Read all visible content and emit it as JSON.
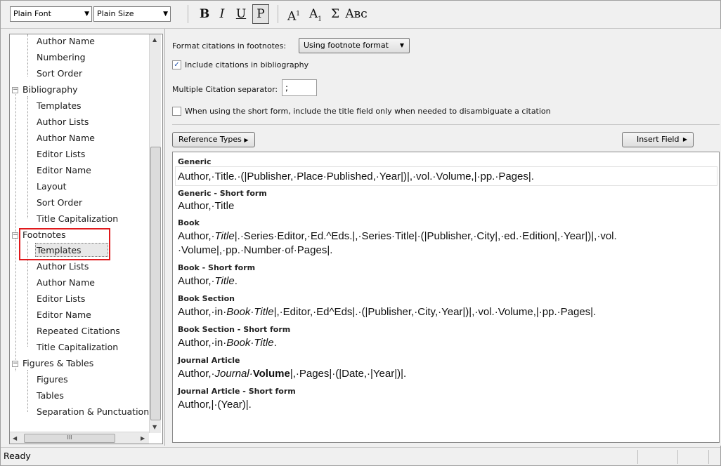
{
  "toolbar": {
    "font": "Plain Font",
    "size": "Plain Size",
    "bold": "B",
    "italic": "I",
    "underline": "U",
    "plain": "P",
    "superscript": "A",
    "superscript_mark": "1",
    "subscript": "A",
    "subscript_mark": "1",
    "symbol": "Σ",
    "smallcaps": "Aʙᴄ"
  },
  "tree": {
    "items": [
      {
        "label": "Author Name"
      },
      {
        "label": "Numbering"
      },
      {
        "label": "Sort Order"
      },
      {
        "label": "Bibliography"
      },
      {
        "label": "Templates"
      },
      {
        "label": "Author Lists"
      },
      {
        "label": "Author Name"
      },
      {
        "label": "Editor Lists"
      },
      {
        "label": "Editor Name"
      },
      {
        "label": "Layout"
      },
      {
        "label": "Sort Order"
      },
      {
        "label": "Title Capitalization"
      },
      {
        "label": "Footnotes"
      },
      {
        "label": "Templates"
      },
      {
        "label": "Author Lists"
      },
      {
        "label": "Author Name"
      },
      {
        "label": "Editor Lists"
      },
      {
        "label": "Editor Name"
      },
      {
        "label": "Repeated Citations"
      },
      {
        "label": "Title Capitalization"
      },
      {
        "label": "Figures & Tables"
      },
      {
        "label": "Figures"
      },
      {
        "label": "Tables"
      },
      {
        "label": "Separation & Punctuation"
      }
    ],
    "collapse_glyph": "−",
    "hscroll_grip": "III"
  },
  "options": {
    "format_label": "Format citations in footnotes:",
    "format_value": "Using footnote format",
    "include_bib_label": "Include citations in bibliography",
    "include_bib_checked": "✓",
    "separator_label": "Multiple Citation separator:",
    "separator_value": ";",
    "short_form_label": "When using the short form, include the title field only when needed to disambiguate a citation",
    "ref_types_button": "Reference Types",
    "insert_field_button": "Insert Field"
  },
  "templates": [
    {
      "header": "Generic",
      "line1": "Author,·Title.·(|Publisher,·Place·Published,·Year|)|,·vol.·Volume,|·pp.·Pages|."
    },
    {
      "header": "Generic - Short form",
      "line1": "Author,·Title"
    },
    {
      "header": "Book",
      "line1a": "Author,·",
      "line1b": "Title",
      "line1c": "|.·Series·Editor,·Ed.^Eds.|,·Series·Title|·(|Publisher,·City|,·ed.·Edition|,·Year|)|,·vol.",
      "line2": "·Volume|,·pp.·Number·of·Pages|."
    },
    {
      "header": "Book - Short form",
      "line1a": "Author,·",
      "line1b": "Title",
      "line1c": "."
    },
    {
      "header": "Book Section",
      "line1a": "Author,·in·",
      "line1b": "Book·Title",
      "line1c": "|,·Editor,·Ed^Eds|.·(|Publisher,·City,·Year|)|,·vol.·Volume,|·pp.·Pages|."
    },
    {
      "header": "Book Section - Short form",
      "line1a": "Author,·in·",
      "line1b": "Book·Title",
      "line1c": "."
    },
    {
      "header": "Journal Article",
      "line1a": "Author,·",
      "line1b": "Journal·",
      "line1bold": "Volume",
      "line1c": "|,·Pages|·(|Date,·|Year|)|."
    },
    {
      "header": "Journal Article - Short form",
      "line1": "Author,|·(Year)|."
    }
  ],
  "status": {
    "text": "Ready"
  }
}
